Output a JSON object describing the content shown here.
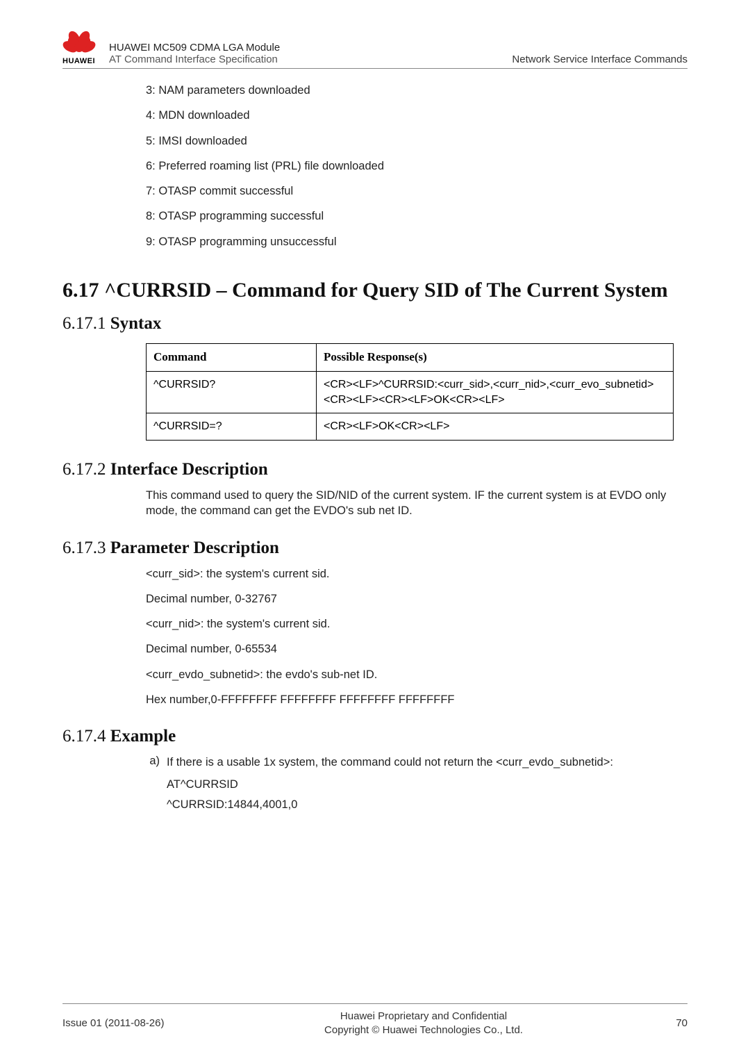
{
  "header": {
    "logo_label": "HUAWEI",
    "title_line1": "HUAWEI MC509 CDMA LGA Module",
    "title_line2": "AT Command Interface Specification",
    "right": "Network Service Interface Commands"
  },
  "status_list": {
    "s3": "3: NAM parameters downloaded",
    "s4": "4: MDN downloaded",
    "s5": "5: IMSI downloaded",
    "s6": "6: Preferred roaming list (PRL) file downloaded",
    "s7": "7: OTASP commit successful",
    "s8": "8: OTASP programming successful",
    "s9": "9: OTASP programming unsuccessful"
  },
  "headings": {
    "main": "6.17 ^CURRSID – Command for Query SID of The Current System",
    "syntax_num": "6.17.1 ",
    "syntax_label": "Syntax",
    "iface_num": "6.17.2 ",
    "iface_label": "Interface Description",
    "param_num": "6.17.3 ",
    "param_label": "Parameter Description",
    "example_num": "6.17.4 ",
    "example_label": "Example"
  },
  "syntax_table": {
    "th_command": "Command",
    "th_response": "Possible Response(s)",
    "r1_cmd": "^CURRSID?",
    "r1_resp": "<CR><LF>^CURRSID:<curr_sid>,<curr_nid>,<curr_evo_subnetid><CR><LF><CR><LF>OK<CR><LF>",
    "r2_cmd": "^CURRSID=?",
    "r2_resp": "<CR><LF>OK<CR><LF>"
  },
  "interface_desc": {
    "p1": "This command used to query the SID/NID of the current system. IF the current system is at EVDO only mode, the command can get the EVDO's sub net ID."
  },
  "param_desc": {
    "p1": "<curr_sid>: the system's current sid.",
    "p2": "Decimal number, 0-32767",
    "p3": "<curr_nid>: the system's current sid.",
    "p4": "Decimal number, 0-65534",
    "p5": "<curr_evdo_subnetid>: the evdo's sub-net ID.",
    "p6": "Hex number,0-FFFFFFFF FFFFFFFF FFFFFFFF FFFFFFFF"
  },
  "example": {
    "a_marker": "a)",
    "a_text": "If there is a usable 1x system, the command could not return the <curr_evdo_subnetid>:",
    "line1": "AT^CURRSID",
    "line2": "^CURRSID:14844,4001,0"
  },
  "footer": {
    "left": "Issue 01 (2011-08-26)",
    "center_line1": "Huawei Proprietary and Confidential",
    "center_line2": "Copyright © Huawei Technologies Co., Ltd.",
    "right": "70"
  }
}
